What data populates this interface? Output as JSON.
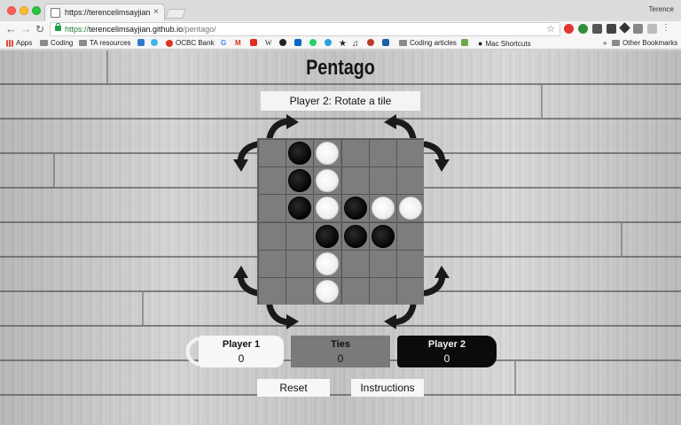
{
  "browser": {
    "tab_title": "https://terencelimsayjian.github.io",
    "tab_close": "×",
    "profile": "Terence",
    "url_scheme": "https://",
    "url_host": "terencelimsayjian.github.io",
    "url_path": "/pentago/",
    "bookmarks": [
      {
        "label": "Apps",
        "icon": "apps-grid-icon"
      },
      {
        "label": "Coding",
        "icon": "folder-icon"
      },
      {
        "label": "TA resources",
        "icon": "folder-icon"
      },
      {
        "label": "OCBC Bank",
        "icon": "ocbc-icon"
      },
      {
        "label": "Coding articles",
        "icon": "folder-icon"
      },
      {
        "label": "Mac Shortcuts",
        "icon": "apple-icon"
      },
      {
        "label": "Other Bookmarks",
        "icon": "folder-icon"
      }
    ],
    "bookmarks_overflow": "»"
  },
  "game": {
    "title": "Pentago",
    "status": "Player 2: Rotate a tile",
    "board": [
      [
        "empty",
        "black",
        "white",
        "empty",
        "empty",
        "empty"
      ],
      [
        "empty",
        "black",
        "white",
        "empty",
        "empty",
        "empty"
      ],
      [
        "empty",
        "black",
        "white",
        "black",
        "white",
        "white"
      ],
      [
        "empty",
        "empty",
        "black",
        "black",
        "black",
        "empty"
      ],
      [
        "empty",
        "empty",
        "white",
        "empty",
        "empty",
        "empty"
      ],
      [
        "empty",
        "empty",
        "white",
        "empty",
        "empty",
        "empty"
      ]
    ],
    "scores": {
      "player1": {
        "label": "Player 1",
        "value": "0"
      },
      "ties": {
        "label": "Ties",
        "value": "0"
      },
      "player2": {
        "label": "Player 2",
        "value": "0"
      }
    },
    "buttons": {
      "reset": "Reset",
      "instructions": "Instructions"
    }
  }
}
